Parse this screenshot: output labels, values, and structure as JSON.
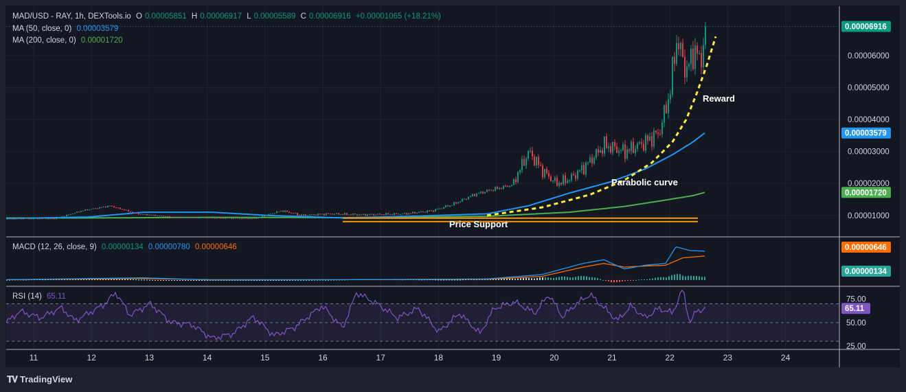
{
  "header": {
    "symbol": "MAD/USD - RAY, 1h, DEXTools.io",
    "o_label": "O",
    "o_value": "0.00005851",
    "h_label": "H",
    "h_value": "0.00006917",
    "l_label": "L",
    "l_value": "0.00005589",
    "c_label": "C",
    "c_value": "0.00006916",
    "change": "+0.00001065 (+18.21%)"
  },
  "ma50": {
    "label": "MA (50, close, 0)",
    "value": "0.00003579"
  },
  "ma200": {
    "label": "MA (200, close, 0)",
    "value": "0.00001720"
  },
  "macd_legend": {
    "label": "MACD (12, 26, close, 9)",
    "hist": "0.00000134",
    "macd": "0.00000780",
    "signal": "0.00000646"
  },
  "rsi_legend": {
    "label": "RSI (14)",
    "value": "65.11"
  },
  "annotations": {
    "reward": "Reward",
    "parabolic": "Parabolic curve",
    "support": "Price Support"
  },
  "badges": {
    "price": "0.00006916",
    "ma50": "0.00003579",
    "ma200": "0.00001720",
    "macd_signal": "0.00000646",
    "macd_hist": "0.00000134",
    "rsi": "65.11"
  },
  "brand": "TradingView",
  "colors": {
    "up": "#089981",
    "down": "#f23645",
    "ma50": "#2196f3",
    "ma200": "#4caf50",
    "curve": "#ffeb3b",
    "support": "#ff9800",
    "rsi": "#7e57c2",
    "macd_signal": "#ff6d00"
  },
  "chart_data": {
    "type": "candlestick",
    "x_ticks": [
      "11",
      "12",
      "13",
      "14",
      "15",
      "16",
      "17",
      "18",
      "19",
      "20",
      "21",
      "22",
      "23",
      "24"
    ],
    "price_ticks": [
      "0.00006000",
      "0.00005000",
      "0.00004000",
      "0.00003000",
      "0.00002000",
      "0.00001000"
    ],
    "price_ylim": [
      3.5e-06,
      7.55e-05
    ],
    "rsi_ticks": [
      "75.00",
      "50.00",
      "25.00"
    ],
    "rsi_ylim": [
      22,
      88
    ],
    "rsi_band": [
      30,
      70
    ],
    "macd_ylim": [
      -1.5e-06,
      1.15e-05
    ],
    "last_close": 6.916e-05,
    "support_level": 8.7e-06,
    "anchors": [
      [
        0,
        9e-06
      ],
      [
        70,
        9e-06
      ],
      [
        110,
        1.15e-05
      ],
      [
        150,
        1.3e-05
      ],
      [
        190,
        1.05e-05
      ],
      [
        240,
        9.5e-06
      ],
      [
        300,
        9.2e-06
      ],
      [
        360,
        9e-06
      ],
      [
        400,
        1.15e-05
      ],
      [
        430,
        1e-05
      ],
      [
        470,
        1.05e-05
      ],
      [
        520,
        1.02e-05
      ],
      [
        580,
        1.05e-05
      ],
      [
        620,
        1.15e-05
      ],
      [
        650,
        1.35e-05
      ],
      [
        680,
        1.65e-05
      ],
      [
        705,
        1.8e-05
      ],
      [
        735,
        1.95e-05
      ],
      [
        760,
        3e-05
      ],
      [
        780,
        2.4e-05
      ],
      [
        800,
        2e-05
      ],
      [
        820,
        2.15e-05
      ],
      [
        840,
        2.5e-05
      ],
      [
        870,
        3.2e-05
      ],
      [
        900,
        3e-05
      ],
      [
        930,
        3.3e-05
      ],
      [
        950,
        3.6e-05
      ],
      [
        965,
        4.8e-05
      ],
      [
        975,
        6.5e-05
      ],
      [
        990,
        5.5e-05
      ],
      [
        1000,
        6.2e-05
      ],
      [
        1010,
        5.8e-05
      ],
      [
        1017,
        6.92e-05
      ]
    ],
    "ma50_points": [
      [
        0,
        9e-06
      ],
      [
        120,
        9.5e-06
      ],
      [
        200,
        1.1e-05
      ],
      [
        300,
        1.1e-05
      ],
      [
        380,
        1e-05
      ],
      [
        490,
        9.2e-06
      ],
      [
        600,
        9.8e-06
      ],
      [
        700,
        1.05e-05
      ],
      [
        760,
        1.3e-05
      ],
      [
        820,
        1.7e-05
      ],
      [
        880,
        2.05e-05
      ],
      [
        930,
        2.45e-05
      ],
      [
        970,
        2.9e-05
      ],
      [
        1000,
        3.3e-05
      ],
      [
        1017,
        3.58e-05
      ]
    ],
    "ma200_points": [
      [
        0,
        9.2e-06
      ],
      [
        120,
        9.2e-06
      ],
      [
        300,
        9.4e-06
      ],
      [
        490,
        9.3e-06
      ],
      [
        700,
        9.7e-06
      ],
      [
        820,
        1.1e-05
      ],
      [
        900,
        1.28e-05
      ],
      [
        960,
        1.48e-05
      ],
      [
        1000,
        1.62e-05
      ],
      [
        1017,
        1.72e-05
      ]
    ],
    "curve_points": [
      [
        700,
        1e-05
      ],
      [
        780,
        1.25e-05
      ],
      [
        850,
        1.65e-05
      ],
      [
        900,
        2.1e-05
      ],
      [
        940,
        2.65e-05
      ],
      [
        970,
        3.3e-05
      ],
      [
        990,
        4e-05
      ],
      [
        1005,
        4.8e-05
      ],
      [
        1020,
        5.7e-05
      ],
      [
        1033,
        6.6e-05
      ]
    ],
    "rsi_points": [
      [
        0,
        50
      ],
      [
        20,
        62
      ],
      [
        50,
        55
      ],
      [
        80,
        66
      ],
      [
        100,
        52
      ],
      [
        140,
        68
      ],
      [
        160,
        82
      ],
      [
        180,
        58
      ],
      [
        210,
        70
      ],
      [
        240,
        50
      ],
      [
        270,
        48
      ],
      [
        300,
        33
      ],
      [
        330,
        38
      ],
      [
        360,
        56
      ],
      [
        390,
        36
      ],
      [
        420,
        45
      ],
      [
        460,
        68
      ],
      [
        490,
        44
      ],
      [
        510,
        82
      ],
      [
        540,
        70
      ],
      [
        570,
        55
      ],
      [
        600,
        65
      ],
      [
        630,
        40
      ],
      [
        660,
        60
      ],
      [
        690,
        38
      ],
      [
        710,
        65
      ],
      [
        740,
        72
      ],
      [
        770,
        60
      ],
      [
        790,
        80
      ],
      [
        810,
        56
      ],
      [
        830,
        70
      ],
      [
        850,
        80
      ],
      [
        870,
        66
      ],
      [
        890,
        52
      ],
      [
        910,
        68
      ],
      [
        930,
        55
      ],
      [
        950,
        65
      ],
      [
        970,
        60
      ],
      [
        985,
        86
      ],
      [
        995,
        50
      ],
      [
        1005,
        62
      ],
      [
        1017,
        65.11
      ]
    ],
    "macd_hist_points": [
      [
        0,
        1e-07
      ],
      [
        150,
        4e-07
      ],
      [
        250,
        -2e-07
      ],
      [
        480,
        1e-07
      ],
      [
        520,
        3e-07
      ],
      [
        650,
        1e-07
      ],
      [
        760,
        6e-07
      ],
      [
        800,
        9e-07
      ],
      [
        850,
        1.2e-06
      ],
      [
        880,
        -8e-07
      ],
      [
        900,
        -3e-07
      ],
      [
        940,
        5e-07
      ],
      [
        980,
        1.8e-06
      ],
      [
        1000,
        1.1e-06
      ],
      [
        1017,
        1.3e-06
      ]
    ],
    "macd_line_points": [
      [
        0,
        1e-07
      ],
      [
        200,
        6e-07
      ],
      [
        300,
        0.0
      ],
      [
        500,
        1e-07
      ],
      [
        700,
        3e-07
      ],
      [
        780,
        1.5e-06
      ],
      [
        840,
        4.5e-06
      ],
      [
        870,
        5.5e-06
      ],
      [
        900,
        3e-06
      ],
      [
        930,
        4e-06
      ],
      [
        960,
        4.5e-06
      ],
      [
        975,
        9e-06
      ],
      [
        995,
        8e-06
      ],
      [
        1017,
        7.8e-06
      ]
    ],
    "macd_signal_points": [
      [
        0,
        1e-07
      ],
      [
        200,
        4e-07
      ],
      [
        300,
        1e-07
      ],
      [
        500,
        1e-07
      ],
      [
        700,
        2e-07
      ],
      [
        780,
        1e-06
      ],
      [
        840,
        3.5e-06
      ],
      [
        870,
        4.5e-06
      ],
      [
        900,
        3.5e-06
      ],
      [
        930,
        3.8e-06
      ],
      [
        960,
        4e-06
      ],
      [
        985,
        6e-06
      ],
      [
        1017,
        6.5e-06
      ]
    ]
  }
}
